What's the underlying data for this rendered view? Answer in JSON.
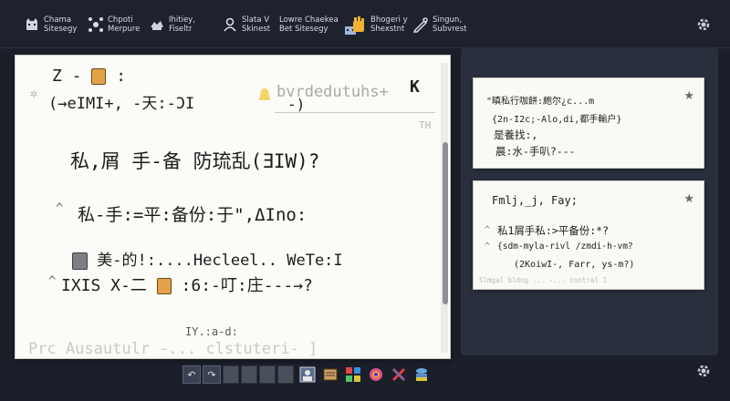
{
  "toolbar": {
    "items": [
      {
        "label": "Chama\nSitesegy",
        "icon": "cat-icon"
      },
      {
        "label": "Chpoti\nMerpure",
        "icon": "molecule-icon"
      },
      {
        "label": "Ihitiey,\nFiseltr",
        "icon": "wolf-icon"
      },
      {
        "label": "Slata V\nSkinest",
        "icon": "person-icon"
      },
      {
        "label": "Lowre Chaekea\nBet Sitesegy",
        "icon": "cat-face-icon"
      },
      {
        "label": "Bhogeri y\nShexstnt",
        "icon": "hand-icon"
      },
      {
        "label": "Singun,\nSubvrest",
        "icon": "pen-icon"
      }
    ]
  },
  "main_note": {
    "line1": "Z -",
    "line1b": ":",
    "line2": "(→eIMI+, -天:-ƆI",
    "header_faint": "bvrdedutuhs+",
    "header_paren": "-)",
    "header_k": "K",
    "header_right": "TH",
    "line3": "私,屑 手-备 防琉乱(ƎIW)?",
    "line4": "私-手:=平:备份:于\",ΔIno:",
    "line5": "美-的!:....Hecleel.. WeTe:I",
    "line6": "IXIS X-二",
    "line6b": ":6:-叮:庄---→?",
    "line7": "IY.:a-d:",
    "bottom_faint": "Prc Ausautulr -... clstuteri- ]"
  },
  "side_card_1": {
    "line1": "\"瞋私行咖餅:皰尔¿c...m",
    "line2": "{2n-I2c;-Alo,di,都手輸户}",
    "line3": "是養找:,",
    "line4": "晨:水-手叭?---"
  },
  "side_card_2": {
    "title": "Fmlj,_j, Fay;",
    "line1": "私1屑手私:>平备份:*?",
    "line2": "{sdm-myla-rivl /zmdi-h-vm?",
    "line3": "(2KoiwI-, Farr, ys-m?)",
    "footer": "Slmgal bldog ... -... contral 1"
  },
  "bottom_toolbar": {
    "undo": "↶",
    "redo": "↷",
    "icons": [
      "portrait-icon",
      "scroll-icon",
      "palette-icon",
      "flower-icon",
      "cross-icon",
      "stack-icon"
    ]
  },
  "colors": {
    "background": "#1b1f2a",
    "card": "#fbfbf7",
    "panel": "#2a2f3d",
    "sticker": "#e3a24a"
  }
}
